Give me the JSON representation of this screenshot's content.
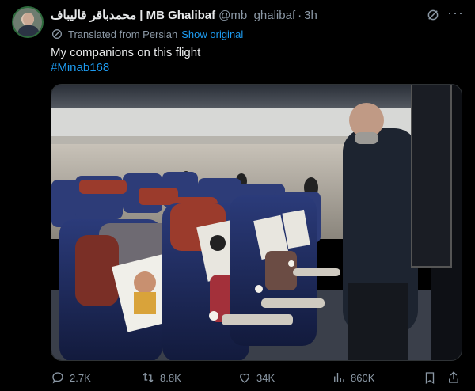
{
  "author": {
    "display_name": "محمدباقر قالیباف | MB Ghalibaf",
    "handle": "@mb_ghalibaf",
    "time": "3h"
  },
  "translation": {
    "label": "Translated from Persian",
    "show_original": "Show original"
  },
  "body": {
    "text": "My companions on this flight",
    "hashtag": "#Minab168"
  },
  "stats": {
    "replies": "2.7K",
    "reposts": "8.8K",
    "likes": "34K",
    "views": "860K"
  },
  "icons": {
    "grok": "grok-icon",
    "more": "more-icon",
    "translate": "translate-icon",
    "reply": "reply-icon",
    "repost": "repost-icon",
    "like": "heart-icon",
    "views": "views-icon",
    "bookmark": "bookmark-icon",
    "share": "share-icon"
  },
  "colors": {
    "background": "#000000",
    "text": "#e7e9ea",
    "muted": "#8b98a5",
    "link": "#1d9bf0"
  }
}
